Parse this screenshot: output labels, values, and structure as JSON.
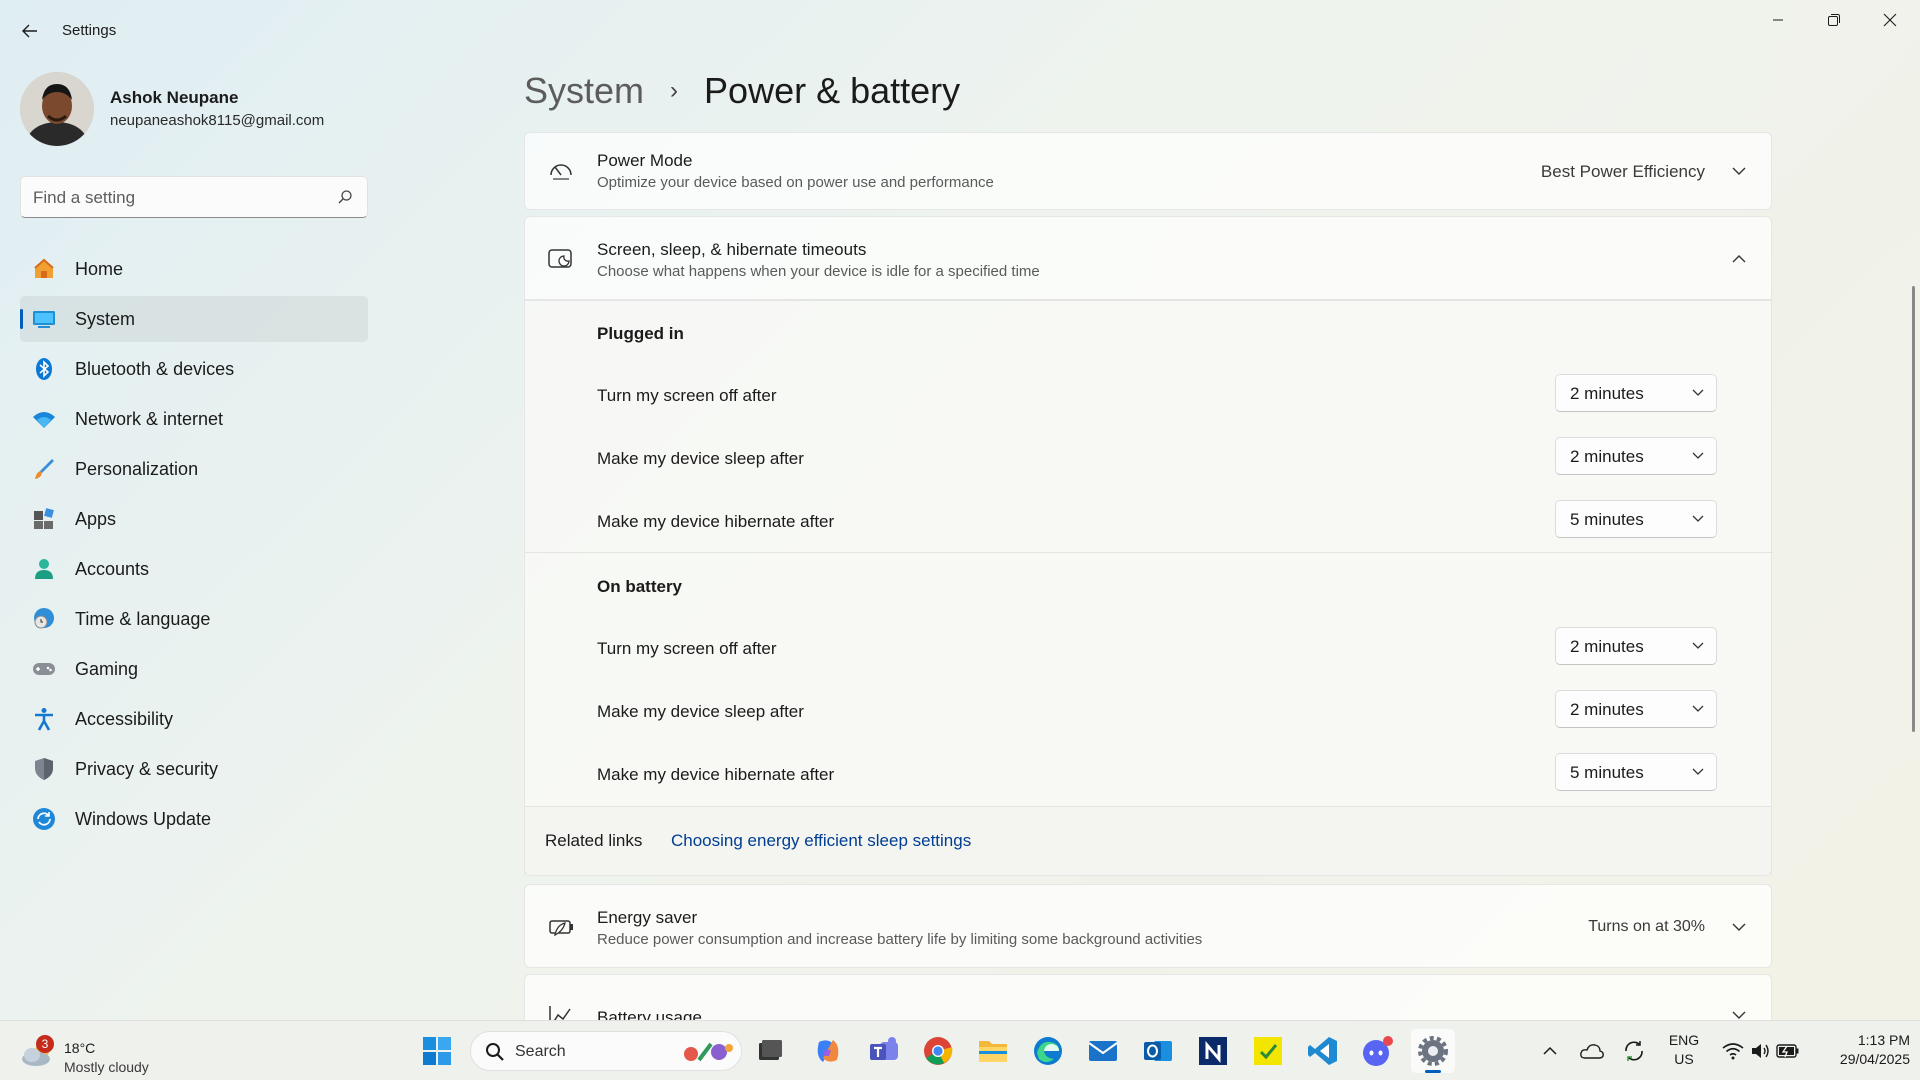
{
  "window": {
    "title": "Settings"
  },
  "profile": {
    "name": "Ashok Neupane",
    "email": "neupaneashok8115@gmail.com"
  },
  "search": {
    "placeholder": "Find a setting"
  },
  "sidebar": {
    "items": [
      {
        "label": "Home",
        "icon": "home-icon"
      },
      {
        "label": "System",
        "icon": "system-icon",
        "active": true
      },
      {
        "label": "Bluetooth & devices",
        "icon": "bluetooth-icon"
      },
      {
        "label": "Network & internet",
        "icon": "wifi-icon"
      },
      {
        "label": "Personalization",
        "icon": "brush-icon"
      },
      {
        "label": "Apps",
        "icon": "apps-icon"
      },
      {
        "label": "Accounts",
        "icon": "person-icon"
      },
      {
        "label": "Time & language",
        "icon": "globe-clock-icon"
      },
      {
        "label": "Gaming",
        "icon": "gamepad-icon"
      },
      {
        "label": "Accessibility",
        "icon": "accessibility-icon"
      },
      {
        "label": "Privacy & security",
        "icon": "shield-icon"
      },
      {
        "label": "Windows Update",
        "icon": "update-icon"
      }
    ]
  },
  "breadcrumb": {
    "parent": "System",
    "separator": "›",
    "current": "Power & battery"
  },
  "power_mode": {
    "title": "Power Mode",
    "description": "Optimize your device based on power use and performance",
    "value": "Best Power Efficiency"
  },
  "timeouts": {
    "title": "Screen, sleep, & hibernate timeouts",
    "description": "Choose what happens when your device is idle for a specified time",
    "plugged_in": {
      "heading": "Plugged in",
      "rows": [
        {
          "label": "Turn my screen off after",
          "value": "2 minutes"
        },
        {
          "label": "Make my device sleep after",
          "value": "2 minutes"
        },
        {
          "label": "Make my device hibernate after",
          "value": "5 minutes"
        }
      ]
    },
    "on_battery": {
      "heading": "On battery",
      "rows": [
        {
          "label": "Turn my screen off after",
          "value": "2 minutes"
        },
        {
          "label": "Make my device sleep after",
          "value": "2 minutes"
        },
        {
          "label": "Make my device hibernate after",
          "value": "5 minutes"
        }
      ]
    }
  },
  "related": {
    "label": "Related links",
    "link": "Choosing energy efficient sleep settings"
  },
  "energy_saver": {
    "title": "Energy saver",
    "description": "Reduce power consumption and increase battery life by limiting some background activities",
    "value": "Turns on at 30%"
  },
  "battery_usage": {
    "title": "Battery usage"
  },
  "taskbar": {
    "weather_temp": "18°C",
    "weather_desc": "Mostly cloudy",
    "weather_badge": "3",
    "search_label": "Search",
    "lang_top": "ENG",
    "lang_bottom": "US",
    "time": "1:13 PM",
    "date": "29/04/2025"
  },
  "colors": {
    "accent": "#005fb8",
    "link": "#003e92"
  }
}
